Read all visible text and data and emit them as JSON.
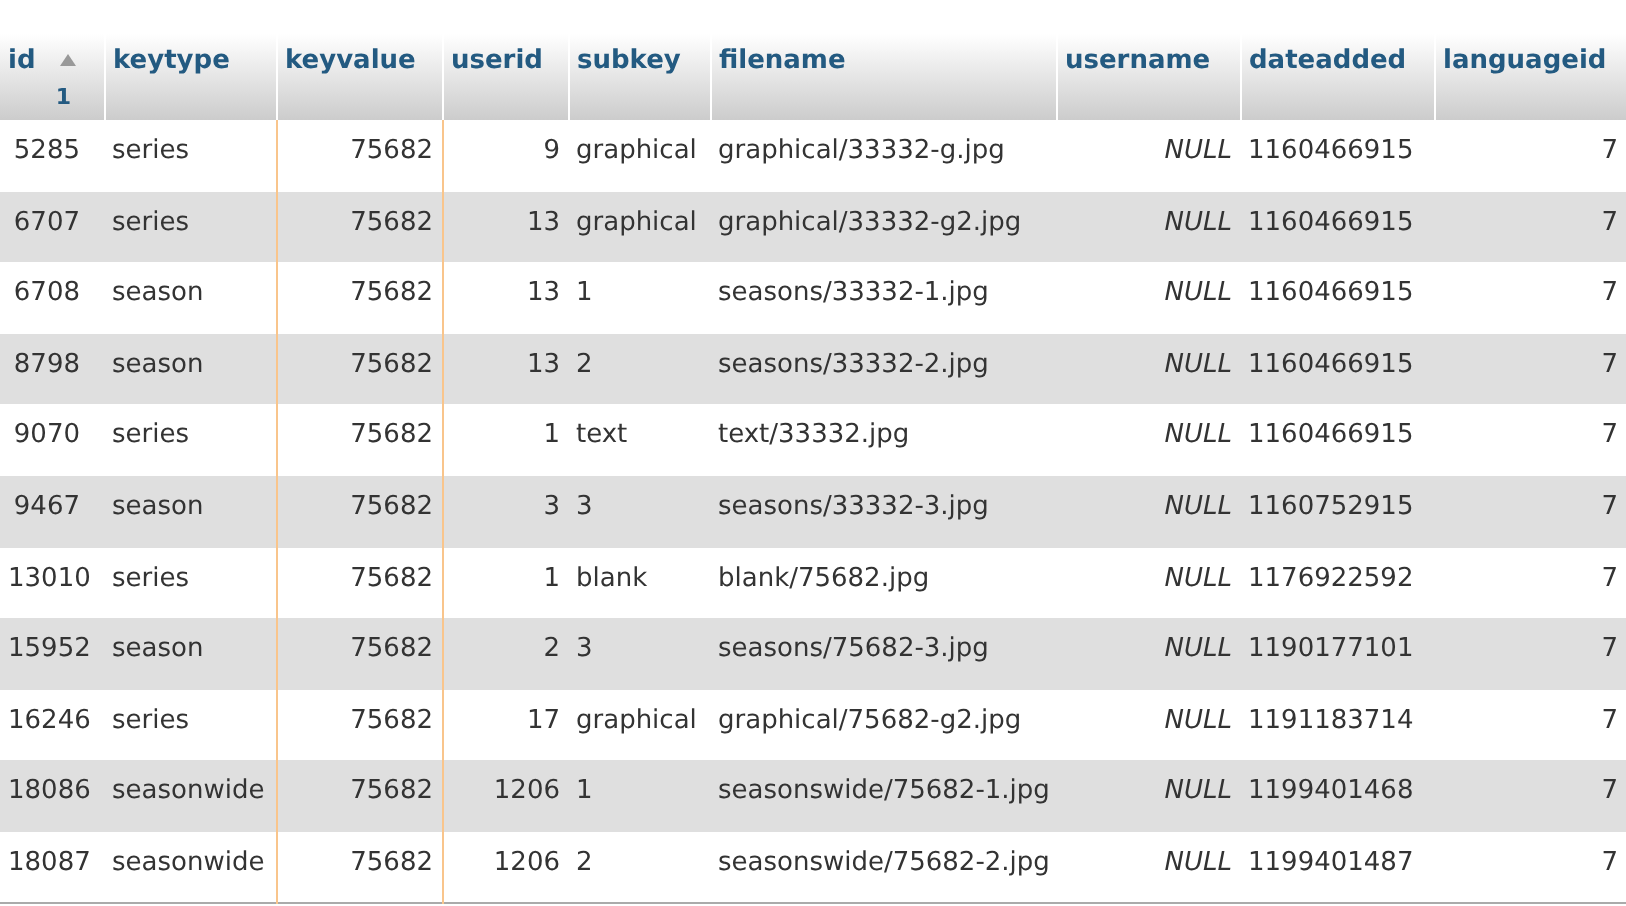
{
  "table": {
    "columns": [
      {
        "label": "id",
        "kind": "number",
        "sorted": true,
        "sort_order": "1",
        "highlighted": false
      },
      {
        "label": "keytype",
        "kind": "text",
        "sorted": false,
        "highlighted": false
      },
      {
        "label": "keyvalue",
        "kind": "number",
        "sorted": false,
        "highlighted": true
      },
      {
        "label": "userid",
        "kind": "number",
        "sorted": false,
        "highlighted": false
      },
      {
        "label": "subkey",
        "kind": "text",
        "sorted": false,
        "highlighted": false
      },
      {
        "label": "filename",
        "kind": "text",
        "sorted": false,
        "highlighted": false
      },
      {
        "label": "username",
        "kind": "null",
        "sorted": false,
        "highlighted": false
      },
      {
        "label": "dateadded",
        "kind": "text",
        "sorted": false,
        "highlighted": false
      },
      {
        "label": "languageid",
        "kind": "number",
        "sorted": false,
        "highlighted": false
      }
    ],
    "rows": [
      [
        "5285",
        "series",
        "75682",
        "9",
        "graphical",
        "graphical/33332-g.jpg",
        "NULL",
        "1160466915",
        "7"
      ],
      [
        "6707",
        "series",
        "75682",
        "13",
        "graphical",
        "graphical/33332-g2.jpg",
        "NULL",
        "1160466915",
        "7"
      ],
      [
        "6708",
        "season",
        "75682",
        "13",
        "1",
        "seasons/33332-1.jpg",
        "NULL",
        "1160466915",
        "7"
      ],
      [
        "8798",
        "season",
        "75682",
        "13",
        "2",
        "seasons/33332-2.jpg",
        "NULL",
        "1160466915",
        "7"
      ],
      [
        "9070",
        "series",
        "75682",
        "1",
        "text",
        "text/33332.jpg",
        "NULL",
        "1160466915",
        "7"
      ],
      [
        "9467",
        "season",
        "75682",
        "3",
        "3",
        "seasons/33332-3.jpg",
        "NULL",
        "1160752915",
        "7"
      ],
      [
        "13010",
        "series",
        "75682",
        "1",
        "blank",
        "blank/75682.jpg",
        "NULL",
        "1176922592",
        "7"
      ],
      [
        "15952",
        "season",
        "75682",
        "2",
        "3",
        "seasons/75682-3.jpg",
        "NULL",
        "1190177101",
        "7"
      ],
      [
        "16246",
        "series",
        "75682",
        "17",
        "graphical",
        "graphical/75682-g2.jpg",
        "NULL",
        "1191183714",
        "7"
      ],
      [
        "18086",
        "seasonwide",
        "75682",
        "1206",
        "1",
        "seasonswide/75682-1.jpg",
        "NULL",
        "1199401468",
        "7"
      ],
      [
        "18087",
        "seasonwide",
        "75682",
        "1206",
        "2",
        "seasonswide/75682-2.jpg",
        "NULL",
        "1199401487",
        "7"
      ]
    ]
  }
}
